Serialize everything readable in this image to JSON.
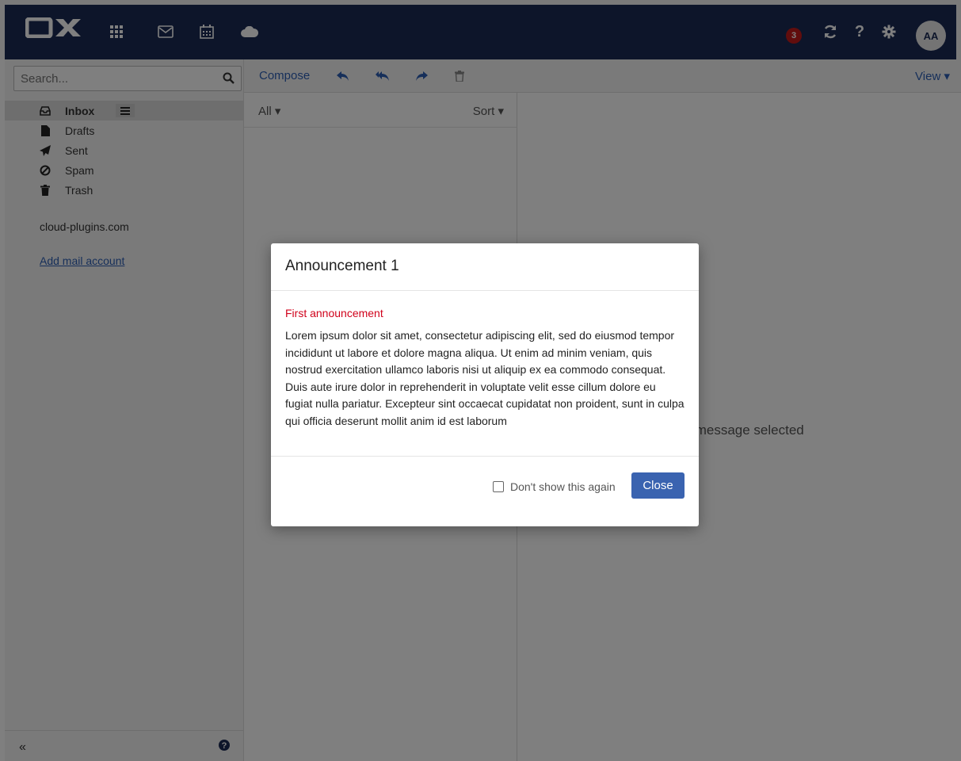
{
  "topbar": {
    "notification_count": "3",
    "avatar_initials": "AA",
    "icons": [
      "grid-icon",
      "mail-icon",
      "calendar-icon",
      "cloud-icon",
      "refresh-icon",
      "help-icon",
      "gear-icon"
    ]
  },
  "search": {
    "placeholder": "Search..."
  },
  "sidebar": {
    "folders": [
      {
        "label": "Inbox",
        "icon": "inbox-icon",
        "active": true
      },
      {
        "label": "Drafts",
        "icon": "drafts-icon"
      },
      {
        "label": "Sent",
        "icon": "sent-icon"
      },
      {
        "label": "Spam",
        "icon": "spam-icon"
      },
      {
        "label": "Trash",
        "icon": "trash-icon"
      }
    ],
    "account": "cloud-plugins.com",
    "add_account": "Add mail account",
    "collapse": "«"
  },
  "toolbar": {
    "compose": "Compose",
    "view": "View"
  },
  "list": {
    "filter": "All",
    "sort": "Sort"
  },
  "detail": {
    "empty_text": "No message selected"
  },
  "modal": {
    "title": "Announcement 1",
    "subtitle": "First announcement",
    "body": "Lorem ipsum dolor sit amet, consectetur adipiscing elit, sed do eiusmod tempor incididunt ut labore et dolore magna aliqua. Ut enim ad minim veniam, quis nostrud exercitation ullamco laboris nisi ut aliquip ex ea commodo consequat. Duis aute irure dolor in reprehenderit in voluptate velit esse cillum dolore eu fugiat nulla pariatur. Excepteur sint occaecat cupidatat non proident, sunt in culpa qui officia deserunt mollit anim id est laborum",
    "dont_show": "Don't show this again",
    "close": "Close"
  },
  "colors": {
    "topbar": "#1b2b55",
    "accent": "#2d5fb5",
    "badge": "#c21b1b",
    "announcement": "#d0021b"
  }
}
